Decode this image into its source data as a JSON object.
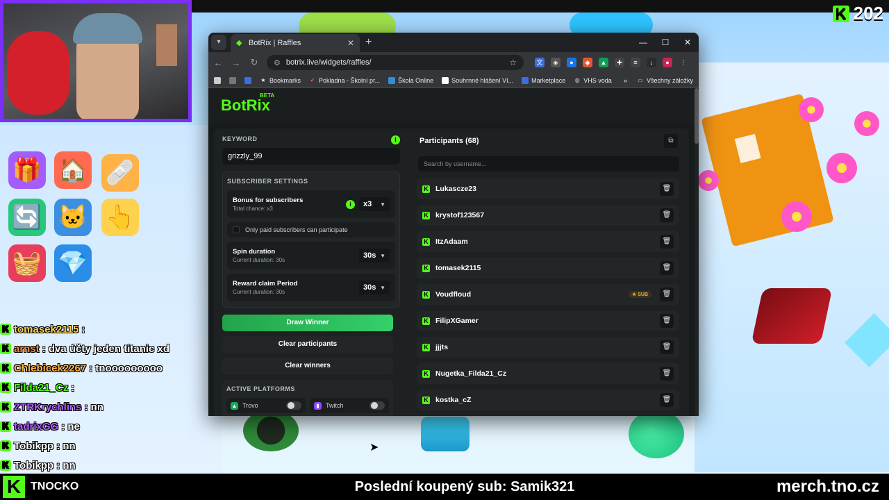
{
  "overlay": {
    "score_value": "202",
    "brand_name": "TNOCKO",
    "last_sub": "Poslední koupený sub: Samik321",
    "merch": "merch.tno.cz"
  },
  "chat": [
    {
      "user": "tomasek2115",
      "message": ":",
      "color": "#ffd24d"
    },
    {
      "user": "arnst",
      "message": ": dva účty jeden titanic xd",
      "color": "#ff8a3d"
    },
    {
      "user": "Chlebicek2267",
      "message": ": tnooooooooo",
      "color": "#ffb347"
    },
    {
      "user": "Filda21_Cz",
      "message": ":",
      "color": "#53fc18"
    },
    {
      "user": "ZTRKrychlins",
      "message": ": nn",
      "color": "#b45cff"
    },
    {
      "user": "tadrixGG",
      "message": ": ne",
      "color": "#b45cff"
    },
    {
      "user": "Tobikpp",
      "message": ": nn",
      "color": "#ffffff"
    },
    {
      "user": "Tobikpp",
      "message": ": nn",
      "color": "#ffffff"
    }
  ],
  "browser": {
    "tab_title": "BotRix | Raffles",
    "url": "botrix.live/widgets/raffles/",
    "bookmarks": [
      "Bookmarks",
      "Pokladna - Školní pr...",
      "Škola Online",
      "Souhrnné hlášení VI...",
      "Marketplace",
      "VHS voda"
    ],
    "bookmarks_all": "Všechny záložky"
  },
  "app": {
    "logo": "BotRix",
    "logo_badge": "BETA",
    "keyword_label": "KEYWORD",
    "keyword_value": "grizzly_99",
    "subscriber_settings_label": "SUBSCRIBER SETTINGS",
    "bonus": {
      "title": "Bonus for subscribers",
      "sub": "Total chance: x3",
      "value": "x3"
    },
    "only_paid": "Only paid subscribers can participate",
    "spin": {
      "title": "Spin duration",
      "sub": "Current duration: 30s",
      "value": "30s"
    },
    "reward": {
      "title": "Reward claim Period",
      "sub": "Current duration: 30s",
      "value": "30s"
    },
    "draw_winner": "Draw Winner",
    "clear_participants": "Clear participants",
    "clear_winners": "Clear winners",
    "active_platforms_label": "ACTIVE PLATFORMS",
    "platforms": [
      {
        "name": "Trovo",
        "color": "#1aa85f"
      },
      {
        "name": "Twitch",
        "color": "#9146ff"
      }
    ],
    "participants_title": "Participants (68)",
    "search_placeholder": "Search by username...",
    "participants": [
      {
        "name": "Lukascze23",
        "sub": ""
      },
      {
        "name": "krystof123567",
        "sub": ""
      },
      {
        "name": "ItzAdaam",
        "sub": ""
      },
      {
        "name": "tomasek2115",
        "sub": ""
      },
      {
        "name": "Voudfloud",
        "sub": "★ SUB"
      },
      {
        "name": "FilipXGamer",
        "sub": ""
      },
      {
        "name": "jjjts",
        "sub": ""
      },
      {
        "name": "Nugetka_Filda21_Cz",
        "sub": ""
      },
      {
        "name": "kostka_cZ",
        "sub": ""
      }
    ],
    "accent": "#53fc18"
  }
}
